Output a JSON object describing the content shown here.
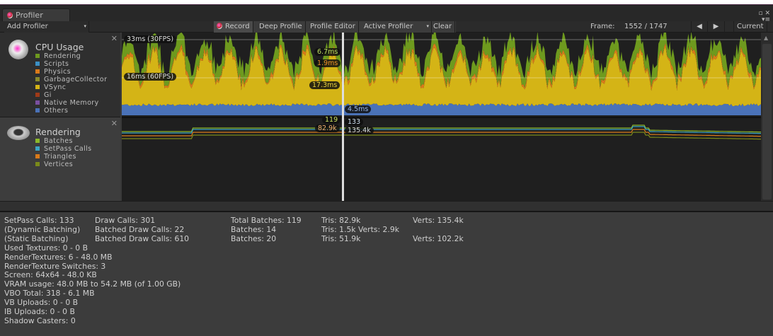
{
  "window": {
    "tab": "Profiler",
    "close_glyph": "✕"
  },
  "toolbar": {
    "add_profiler": "Add Profiler",
    "record": "Record",
    "deep_profile": "Deep Profile",
    "profile_editor": "Profile Editor",
    "active_profiler": "Active Profiler",
    "clear": "Clear",
    "frame_label": "Frame:",
    "frame_value": "1552 / 1747",
    "current": "Current"
  },
  "cpu": {
    "title": "CPU Usage",
    "legend": [
      {
        "label": "Rendering",
        "color": "#6e9a1e"
      },
      {
        "label": "Scripts",
        "color": "#3b8fc4"
      },
      {
        "label": "Physics",
        "color": "#d97a1a"
      },
      {
        "label": "GarbageCollector",
        "color": "#8a8a2a"
      },
      {
        "label": "VSync",
        "color": "#d4b416"
      },
      {
        "label": "Gi",
        "color": "#a03a18"
      },
      {
        "label": "Native Memory",
        "color": "#7a4fa0"
      },
      {
        "label": "Others",
        "color": "#4a72b8"
      }
    ],
    "line_33": "33ms (30FPS)",
    "line_16": "16ms (60FPS)",
    "markers": {
      "rendering": "6.7ms",
      "physics": "1.9ms",
      "vsync": "17.3ms",
      "others": "4.5ms"
    }
  },
  "rendering": {
    "title": "Rendering",
    "legend": [
      {
        "label": "Batches",
        "color": "#8cb82a"
      },
      {
        "label": "SetPass Calls",
        "color": "#3ba4c4"
      },
      {
        "label": "Triangles",
        "color": "#d97a1a"
      },
      {
        "label": "Vertices",
        "color": "#7a8a1a"
      }
    ],
    "markers": {
      "batches": "119",
      "setpass": "133",
      "triangles": "82.9k",
      "vertices": "135.4k"
    }
  },
  "stats": {
    "col1": [
      "SetPass Calls: 133",
      "(Dynamic Batching)",
      "(Static Batching)",
      "Used Textures: 0 - 0 B",
      "RenderTextures: 6 - 48.0 MB",
      "RenderTexture Switches: 3",
      "Screen: 64x64 - 48.0 KB",
      "VRAM usage: 48.0 MB to 54.2 MB (of 1.00 GB)",
      "VBO Total: 318 - 6.1 MB",
      "VB Uploads: 0 - 0 B",
      "IB Uploads: 0 - 0 B",
      "Shadow Casters: 0"
    ],
    "col2": [
      "Draw Calls: 301",
      "Batched Draw Calls: 22",
      "Batched Draw Calls: 610"
    ],
    "col3": [
      "Total Batches: 119",
      "Batches: 14",
      "Batches: 20"
    ],
    "col4": [
      "Tris: 82.9k",
      "Tris: 1.5k  Verts: 2.9k",
      "Tris: 51.9k"
    ],
    "col5": [
      "Verts: 135.4k",
      "",
      "Verts: 102.2k"
    ]
  }
}
